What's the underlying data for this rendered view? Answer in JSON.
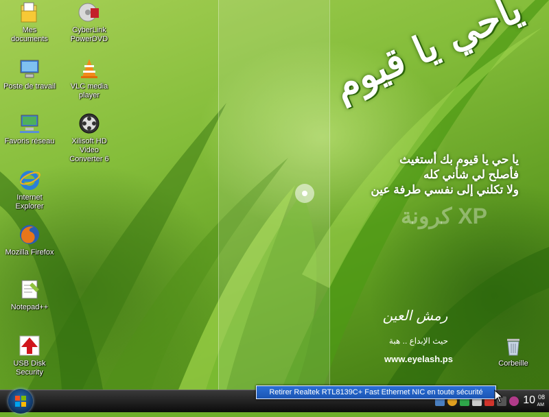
{
  "desktop": {
    "icons": [
      {
        "label": "Mes documents",
        "icon": "my-documents-icon"
      },
      {
        "label": "CyberLink\nPowerDVD",
        "icon": "powerdvd-icon"
      },
      {
        "label": "Poste de travail",
        "icon": "my-computer-icon"
      },
      {
        "label": "VLC media\nplayer",
        "icon": "vlc-icon"
      },
      {
        "label": "Favoris réseau",
        "icon": "network-places-icon"
      },
      {
        "label": "Xilisoft HD Video\nConverter 6",
        "icon": "video-converter-icon"
      },
      {
        "label": "Internet\nExplorer",
        "icon": "internet-explorer-icon"
      },
      {
        "label": "Mozilla Firefox",
        "icon": "firefox-icon"
      },
      {
        "label": "Notepad++",
        "icon": "notepad-plus-plus-icon"
      },
      {
        "label": "USB Disk\nSecurity",
        "icon": "usb-disk-security-icon"
      },
      {
        "label": "Corbeille",
        "icon": "recycle-bin-icon"
      }
    ]
  },
  "wallpaper": {
    "calligraphy": "ياحي يا قيوم",
    "poem_lines": [
      "يا حي يا قيوم بك أستغيث",
      "فأصلح لي شأني كله",
      "ولا تكلني إلى نفسي طرفة عين"
    ],
    "brand": "كرونة XP",
    "signature": "رمش العين",
    "tagline": "حيث الإبداع .. هبة",
    "website": "www.eyelash.ps"
  },
  "taskbar": {
    "start_icon": "windows-orb-icon",
    "balloon_text": "Retirer Realtek RTL8139C+ Fast Ethernet NIC en toute sécurité",
    "clock_hour": "10",
    "clock_minutes": "08",
    "clock_ampm": "AM"
  },
  "colors": {
    "balloon_bg": "#1b55b4",
    "taskbar_bg": "#0b0b0b",
    "wallpaper_green": "#6fae2a"
  }
}
